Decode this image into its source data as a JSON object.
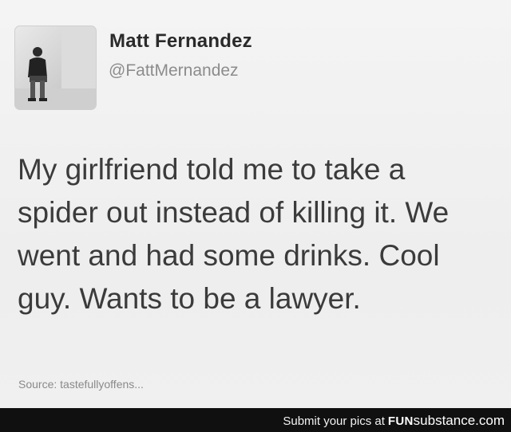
{
  "tweet": {
    "author_name": "Matt Fernandez",
    "author_handle": "@FattMernandez",
    "text_lines": [
      "My girlfriend told me to take a",
      "spider out instead of killing it. We",
      "went and had some drinks. Cool",
      "guy. Wants to be a lawyer."
    ],
    "source": "Source: tastefullyoffens..."
  },
  "footer": {
    "prefix": "Submit your pics at",
    "brand_fun": "FUN",
    "brand_sub": "substance.com"
  },
  "icons": {
    "avatar": "avatar-photo"
  }
}
